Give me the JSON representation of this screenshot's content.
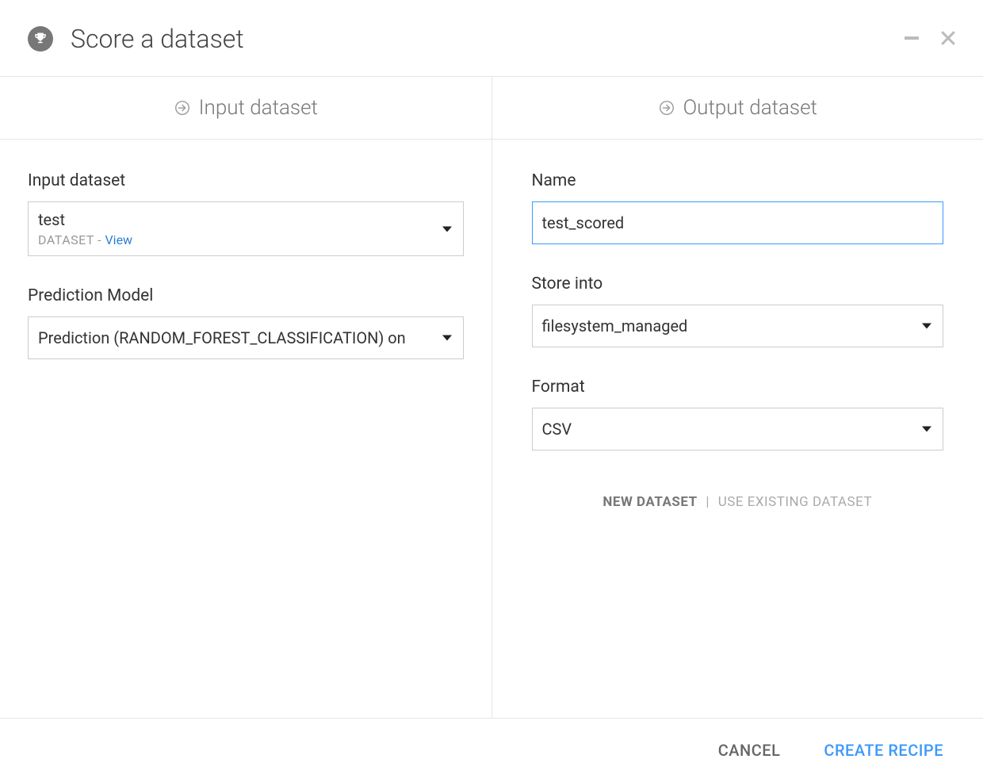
{
  "header": {
    "title": "Score a dataset"
  },
  "left": {
    "header": "Input dataset",
    "input_dataset": {
      "label": "Input dataset",
      "value": "test",
      "meta_label": "DATASET",
      "meta_separator": " - ",
      "view_link": "View"
    },
    "prediction_model": {
      "label": "Prediction Model",
      "value": "Prediction (RANDOM_FOREST_CLASSIFICATION) on"
    }
  },
  "right": {
    "header": "Output dataset",
    "name": {
      "label": "Name",
      "value": "test_scored"
    },
    "store_into": {
      "label": "Store into",
      "value": "filesystem_managed"
    },
    "format": {
      "label": "Format",
      "value": "CSV"
    },
    "toggle": {
      "new_dataset": "NEW DATASET",
      "use_existing": "USE EXISTING DATASET"
    }
  },
  "footer": {
    "cancel": "CANCEL",
    "create": "CREATE RECIPE"
  }
}
